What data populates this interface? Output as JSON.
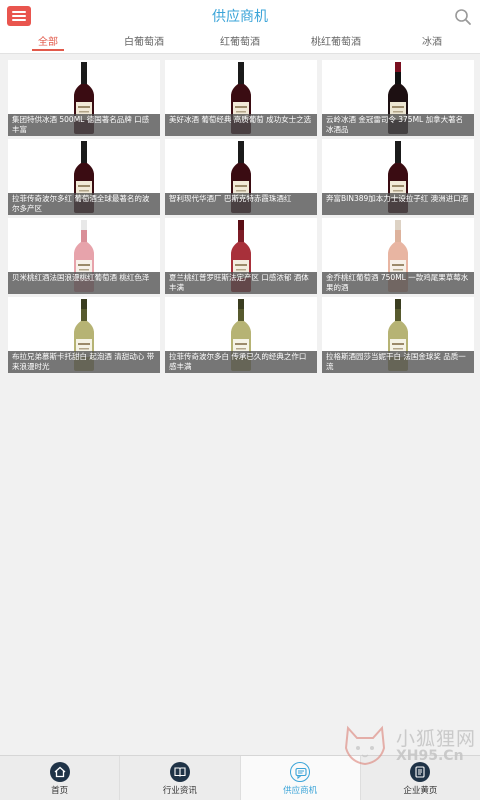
{
  "header": {
    "title": "供应商机"
  },
  "tabs": [
    {
      "label": "全部"
    },
    {
      "label": "白葡萄酒"
    },
    {
      "label": "红葡萄酒"
    },
    {
      "label": "桃红葡萄酒"
    },
    {
      "label": "冰酒"
    }
  ],
  "products": [
    {
      "name": "集团特供冰酒 500ML 德国著名品牌 口感丰富",
      "bottle": "red"
    },
    {
      "name": "美好冰酒 葡萄经典 高质葡萄 成功女士之选",
      "bottle": "red"
    },
    {
      "name": "云岭冰酒 金冠雷司令 375ML 加拿大著名冰酒品",
      "bottle": "dark"
    },
    {
      "name": "拉菲传奇波尔多红 葡萄酒全球最著名的波尔多产区",
      "bottle": "red"
    },
    {
      "name": "智利现代华酒厂 巴斯克特赤霞珠酒红",
      "bottle": "red"
    },
    {
      "name": "奔富BIN389加本力士设拉子红 澳洲进口酒",
      "bottle": "red"
    },
    {
      "name": "贝米桃红酒法国浪漫桃红葡萄酒 桃红色泽",
      "bottle": "rose"
    },
    {
      "name": "夏兰桃红普罗旺斯法定产区 口感浓郁 酒体丰满",
      "bottle": "rosered"
    },
    {
      "name": "金乔桃红葡萄酒 750ML 一款鸡尾果草莓水果的酒",
      "bottle": "pink"
    },
    {
      "name": "布拉兄弟慕斯卡托甜白 起泡酒 清甜动心 带来浪漫时光",
      "bottle": "white"
    },
    {
      "name": "拉菲传奇波尔多白 传承已久的经典之作口感丰满",
      "bottle": "white"
    },
    {
      "name": "拉格斯酒园莎当妮干白 法国金球奖 品质一流",
      "bottle": "white"
    }
  ],
  "bottom_nav": [
    {
      "label": "首页",
      "icon": "home-icon"
    },
    {
      "label": "行业资讯",
      "icon": "book-icon"
    },
    {
      "label": "供应商机",
      "icon": "chat-icon"
    },
    {
      "label": "企业黄页",
      "icon": "pages-icon"
    }
  ],
  "watermark": {
    "text": "小狐狸网",
    "url": "XH95.Cn"
  },
  "colors": {
    "accent_blue": "#3ba4d8",
    "accent_red": "#e25a4b",
    "menu_red": "#e9554e"
  }
}
